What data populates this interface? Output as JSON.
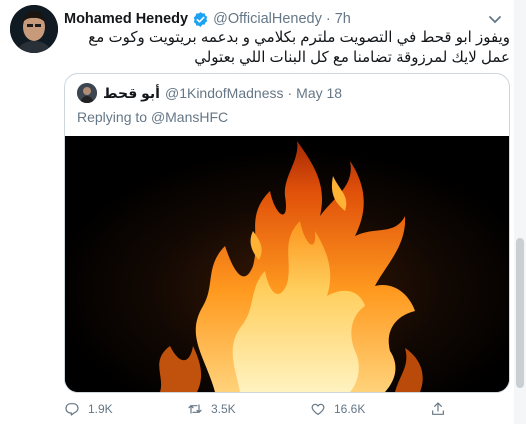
{
  "author": {
    "name": "Mohamed Henedy",
    "handle": "@OfficialHenedy",
    "separator": "·",
    "time": "7h"
  },
  "tweet": {
    "text": "ويفوز ابو قحط في التصويت ملترم بكلامي و بدعمه بريتويت وكوت مع عمل لايك لمرزوقة تضامنا مع كل البنات اللي بعتولي"
  },
  "quoted": {
    "name": "أبو قحط",
    "handle": "@1KindofMadness",
    "separator": "·",
    "time": "May 18",
    "replying_label": "Replying to",
    "replying_to": "@MansHFC"
  },
  "actions": {
    "reply_count": "1.9K",
    "retweet_count": "3.5K",
    "like_count": "16.6K"
  },
  "colors": {
    "text": "#14171a",
    "secondary": "#657786",
    "verified": "#1da1f2",
    "border": "#ccd6dd"
  },
  "icons": [
    "verified-badge-icon",
    "caret-down-icon",
    "reply-icon",
    "retweet-icon",
    "like-icon",
    "share-icon"
  ]
}
